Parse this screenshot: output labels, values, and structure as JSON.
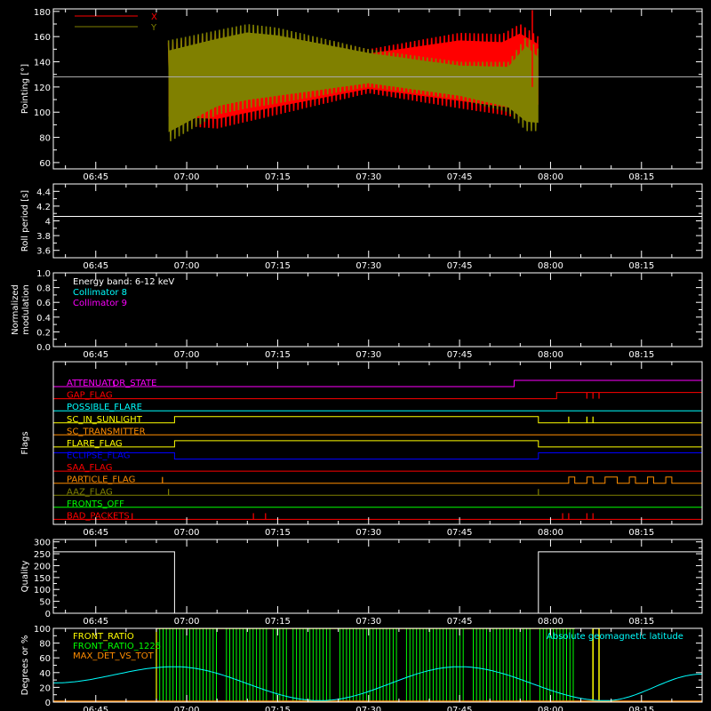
{
  "chart_data": [
    {
      "id": "pointing",
      "type": "line",
      "ylabel": "Pointing [°]",
      "ylim": [
        55,
        182
      ],
      "yticks": [
        60,
        80,
        100,
        120,
        140,
        160,
        180
      ],
      "xlim": [
        "06:38",
        "08:25"
      ],
      "xticks": [
        "06:45",
        "07:00",
        "07:15",
        "07:30",
        "07:45",
        "08:00",
        "08:15"
      ],
      "reference_line": 128,
      "legend": [
        {
          "label": "X",
          "color": "#ff0000"
        },
        {
          "label": "Y",
          "color": "#808000"
        }
      ],
      "series": [
        {
          "name": "X",
          "color": "#ff0000",
          "envelope": [
            {
              "t": "06:57",
              "lo": 90,
              "hi": 155
            },
            {
              "t": "07:05",
              "lo": 87,
              "hi": 163
            },
            {
              "t": "07:15",
              "lo": 98,
              "hi": 163
            },
            {
              "t": "07:30",
              "lo": 115,
              "hi": 150
            },
            {
              "t": "07:45",
              "lo": 103,
              "hi": 163
            },
            {
              "t": "07:52",
              "lo": 98,
              "hi": 162
            },
            {
              "t": "07:55",
              "lo": 95,
              "hi": 170
            },
            {
              "t": "07:58",
              "lo": 100,
              "hi": 160
            }
          ]
        },
        {
          "name": "Y",
          "color": "#808000",
          "envelope": [
            {
              "t": "06:57",
              "lo": 76,
              "hi": 157
            },
            {
              "t": "07:05",
              "lo": 98,
              "hi": 165
            },
            {
              "t": "07:10",
              "lo": 103,
              "hi": 170
            },
            {
              "t": "07:15",
              "lo": 107,
              "hi": 167
            },
            {
              "t": "07:30",
              "lo": 120,
              "hi": 150
            },
            {
              "t": "07:45",
              "lo": 110,
              "hi": 140
            },
            {
              "t": "07:53",
              "lo": 100,
              "hi": 140
            },
            {
              "t": "07:56",
              "lo": 85,
              "hi": 160
            },
            {
              "t": "07:58",
              "lo": 85,
              "hi": 150
            }
          ]
        }
      ]
    },
    {
      "id": "roll",
      "type": "line",
      "ylabel": "Roll period [s]",
      "ylim": [
        3.5,
        4.5
      ],
      "yticks": [
        3.6,
        3.8,
        4.0,
        4.2,
        4.4
      ],
      "xlim": [
        "06:38",
        "08:25"
      ],
      "xticks": [
        "06:45",
        "07:00",
        "07:15",
        "07:30",
        "07:45",
        "08:00",
        "08:15"
      ],
      "series": [
        {
          "name": "",
          "color": "#ffffff",
          "x": [
            "06:38",
            "08:25"
          ],
          "y": [
            4.06,
            4.06
          ]
        }
      ]
    },
    {
      "id": "modulation",
      "type": "line",
      "ylabel": "Normalized modulation",
      "ylabel_lines": [
        "Normalized",
        "modulation"
      ],
      "ylim": [
        0,
        1.0
      ],
      "yticks": [
        0.0,
        0.2,
        0.4,
        0.6,
        0.8,
        1.0
      ],
      "yticklabels": [
        "0.0",
        "0.2",
        "0.4",
        "0.6",
        "0.8",
        "1.0"
      ],
      "xlim": [
        "06:38",
        "08:25"
      ],
      "xticks": [
        "06:45",
        "07:00",
        "07:15",
        "07:30",
        "07:45",
        "08:00",
        "08:15"
      ],
      "annotations": [
        {
          "text": "Energy band: 6-12 keV",
          "color": "#ffffff"
        },
        {
          "text": "Collimator 8",
          "color": "#00ffff"
        },
        {
          "text": "Collimator 9",
          "color": "#ff00ff"
        }
      ],
      "series": [
        {
          "name": "Collimator 9",
          "color": "#ff00ff",
          "x": [
            "06:38",
            "08:25"
          ],
          "y": [
            0.0,
            0.0
          ]
        }
      ]
    },
    {
      "id": "flags",
      "type": "line",
      "ylabel": "Flags",
      "xlim": [
        "06:38",
        "08:25"
      ],
      "xticks": [
        "06:45",
        "07:00",
        "07:15",
        "07:30",
        "07:45",
        "08:00",
        "08:15"
      ],
      "flags": [
        {
          "label": "ATTENUATOR_STATE",
          "color": "#ff00ff",
          "high": [
            [
              "07:54",
              "08:25"
            ]
          ],
          "spikes": [
            "06:48"
          ]
        },
        {
          "label": "GAP_FLAG",
          "color": "#ff0000",
          "high": [
            [
              "08:01",
              "08:25"
            ]
          ],
          "spikes": [
            "08:06",
            "08:07",
            "08:08"
          ]
        },
        {
          "label": "POSSIBLE_FLARE",
          "color": "#00ffff",
          "high": [],
          "spikes": []
        },
        {
          "label": "SC_IN_SUNLIGHT",
          "color": "#ffff00",
          "high": [
            [
              "06:58",
              "07:58"
            ]
          ],
          "spikes": [
            "08:03",
            "08:06",
            "08:07"
          ]
        },
        {
          "label": "SC_TRANSMITTER",
          "color": "#ff8c00",
          "high": [],
          "spikes": []
        },
        {
          "label": "FLARE_FLAG",
          "color": "#ffff00",
          "high": [
            [
              "06:58",
              "07:58"
            ]
          ],
          "spikes": []
        },
        {
          "label": "ECLIPSE_FLAG",
          "color": "#0000ff",
          "high": [
            [
              "06:38",
              "06:58"
            ],
            [
              "07:58",
              "08:25"
            ]
          ],
          "spikes": []
        },
        {
          "label": "SAA_FLAG",
          "color": "#ff0000",
          "high": [],
          "spikes": []
        },
        {
          "label": "PARTICLE_FLAG",
          "color": "#ff8c00",
          "high": [
            [
              "08:03",
              "08:04"
            ],
            [
              "08:06",
              "08:07"
            ],
            [
              "08:09",
              "08:11"
            ],
            [
              "08:13",
              "08:14"
            ],
            [
              "08:16",
              "08:17"
            ],
            [
              "08:19",
              "08:20"
            ]
          ],
          "spikes": [
            "06:38",
            "06:56"
          ]
        },
        {
          "label": "AAZ_FLAG",
          "color": "#808000",
          "high": [],
          "spikes": [
            "06:57",
            "07:58"
          ]
        },
        {
          "label": "FRONTS_OFF",
          "color": "#00ff00",
          "high": [],
          "spikes": []
        },
        {
          "label": "BAD_PACKETS",
          "color": "#ff0000",
          "high": [],
          "spikes": [
            "06:51",
            "07:11",
            "07:13",
            "08:02",
            "08:03",
            "08:06",
            "08:07"
          ]
        }
      ]
    },
    {
      "id": "quality",
      "type": "line",
      "ylabel": "Quality",
      "ylim": [
        0,
        310
      ],
      "yticks": [
        0,
        50,
        100,
        150,
        200,
        250,
        300
      ],
      "xlim": [
        "06:38",
        "08:25"
      ],
      "xticks": [
        "06:45",
        "07:00",
        "07:15",
        "07:30",
        "07:45",
        "08:00",
        "08:15"
      ],
      "series": [
        {
          "name": "",
          "color": "#ffffff",
          "x": [
            "06:38",
            "06:58",
            "06:58",
            "07:58",
            "07:58",
            "08:25"
          ],
          "y": [
            258,
            258,
            0,
            0,
            258,
            258
          ]
        }
      ]
    },
    {
      "id": "ratios",
      "type": "line",
      "ylabel": "Degrees or %",
      "ylim": [
        0,
        100
      ],
      "yticks": [
        0,
        20,
        40,
        60,
        80,
        100
      ],
      "xlim": [
        "06:38",
        "08:25"
      ],
      "xticks": [
        "06:45",
        "07:00",
        "07:15",
        "07:30",
        "07:45",
        "08:00",
        "08:15"
      ],
      "legend": [
        {
          "label": "FRONT_RATIO",
          "color": "#ffff00"
        },
        {
          "label": "FRONT_RATIO_1225",
          "color": "#00ff00"
        },
        {
          "label": "MAX_DET_VS_TOT",
          "color": "#ff8c00"
        }
      ],
      "annotation_right": {
        "text": "Absolute geomagnetic latitude",
        "color": "#00ffff"
      },
      "green_band": [
        "06:55",
        "08:04"
      ],
      "yellow_spikes": [
        "08:07",
        "08:08"
      ],
      "latitude": {
        "color": "#00ffff",
        "x": [
          "06:38",
          "06:58",
          "07:22",
          "07:45",
          "08:09",
          "08:25"
        ],
        "y": [
          26,
          48,
          2,
          48,
          2,
          38
        ]
      }
    }
  ]
}
